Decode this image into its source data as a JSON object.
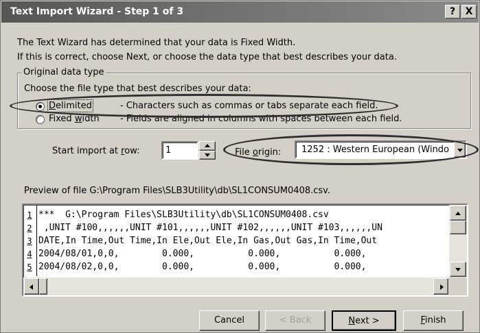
{
  "window": {
    "title": "Text Import Wizard - Step 1 of 3",
    "help_glyph": "?",
    "close_glyph": "X"
  },
  "intro": {
    "line1": "The Text Wizard has determined that your data is Fixed Width.",
    "line2": "If this is correct, choose Next, or choose the data type that best describes your data."
  },
  "group": {
    "legend": "Original data type",
    "prompt": "Choose the file type that best describes your data:",
    "options": [
      {
        "label_pre": "",
        "label_key": "D",
        "label_post": "elimited",
        "desc": "- Characters such as commas or tabs separate each field.",
        "selected": true
      },
      {
        "label_pre": "Fixed ",
        "label_key": "w",
        "label_post": "idth",
        "desc": "- Fields are aligned in columns with spaces between each field.",
        "selected": false
      }
    ]
  },
  "start_row": {
    "label_pre": "Start import at ",
    "label_key": "r",
    "label_post": "ow:",
    "value": "1"
  },
  "file_origin": {
    "label_pre": "File ",
    "label_key": "o",
    "label_post": "rigin:",
    "value": "1252 : Western European (Windo"
  },
  "preview": {
    "caption": "Preview of file G:\\Program Files\\SLB3Utility\\db\\SL1CONSUM0408.csv.",
    "rows": [
      {
        "num": "1",
        "text": "***  G:\\Program Files\\SLB3Utility\\db\\SL1CONSUM0408.csv"
      },
      {
        "num": "2",
        "text": " ,UNIT #100,,,,,,UNIT #101,,,,,,UNIT #102,,,,,,UNIT #103,,,,,,UN"
      },
      {
        "num": "3",
        "text": "DATE,In Time,Out Time,In Ele,Out Ele,In Gas,Out Gas,In Time,Out"
      },
      {
        "num": "4",
        "text": "2004/08/01,0,0,        0.000,          0.000,          0.000,"
      },
      {
        "num": "5",
        "text": "2004/08/02,0,0,        0.000,          0.000,          0.000,"
      }
    ]
  },
  "buttons": {
    "cancel": "Cancel",
    "back": "< Back",
    "next_pre": "",
    "next_key": "N",
    "next_post": "ext >",
    "finish_pre": "",
    "finish_key": "F",
    "finish_post": "inish"
  },
  "colors": {
    "face": "#d4d0c8",
    "titlebar": "#555555",
    "disabled_text": "#a0a0a0"
  }
}
